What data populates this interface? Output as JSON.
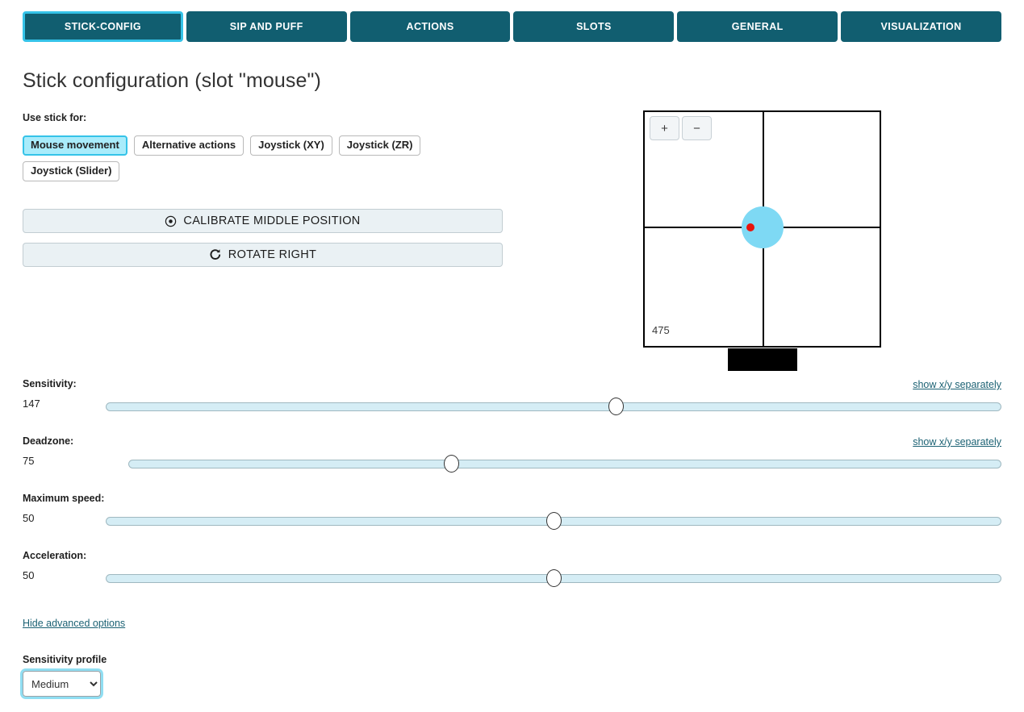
{
  "tabs": [
    {
      "label": "STICK-CONFIG",
      "active": true
    },
    {
      "label": "SIP AND PUFF",
      "active": false
    },
    {
      "label": "ACTIONS",
      "active": false
    },
    {
      "label": "SLOTS",
      "active": false
    },
    {
      "label": "GENERAL",
      "active": false
    },
    {
      "label": "VISUALIZATION",
      "active": false
    }
  ],
  "page": {
    "title": "Stick configuration (slot \"mouse\")"
  },
  "use_stick": {
    "label": "Use stick for:",
    "options": [
      {
        "label": "Mouse movement",
        "selected": true
      },
      {
        "label": "Alternative actions",
        "selected": false
      },
      {
        "label": "Joystick (XY)",
        "selected": false
      },
      {
        "label": "Joystick (ZR)",
        "selected": false
      },
      {
        "label": "Joystick (Slider)",
        "selected": false
      }
    ]
  },
  "actions": {
    "calibrate": {
      "label": "CALIBRATE MIDDLE POSITION",
      "icon": "target-icon"
    },
    "rotate": {
      "label": "ROTATE RIGHT",
      "icon": "rotate-right-icon"
    }
  },
  "visualization": {
    "zoom_in_label": "+",
    "zoom_out_label": "−",
    "reading": "475",
    "deadzone_color": "#7ed9f4",
    "position_color": "#e8130b"
  },
  "sliders": [
    {
      "label": "Sensitivity:",
      "value": "147",
      "percent": 57,
      "link": "show x/y separately",
      "has_link": true
    },
    {
      "label": "Deadzone:",
      "value": "75",
      "percent": 37,
      "link": "show x/y separately",
      "has_link": true
    },
    {
      "label": "Maximum speed:",
      "value": "50",
      "percent": 50,
      "link": "",
      "has_link": false
    },
    {
      "label": "Acceleration:",
      "value": "50",
      "percent": 50,
      "link": "",
      "has_link": false
    }
  ],
  "advanced": {
    "toggle_label": "Hide advanced options",
    "profile_label": "Sensitivity profile",
    "profile_value": "Medium",
    "profile_options": [
      "Medium"
    ]
  },
  "colors": {
    "tab_bg": "#115e70",
    "accent": "#35c3e8",
    "link": "#1c6274",
    "track": "#d5edf5"
  }
}
